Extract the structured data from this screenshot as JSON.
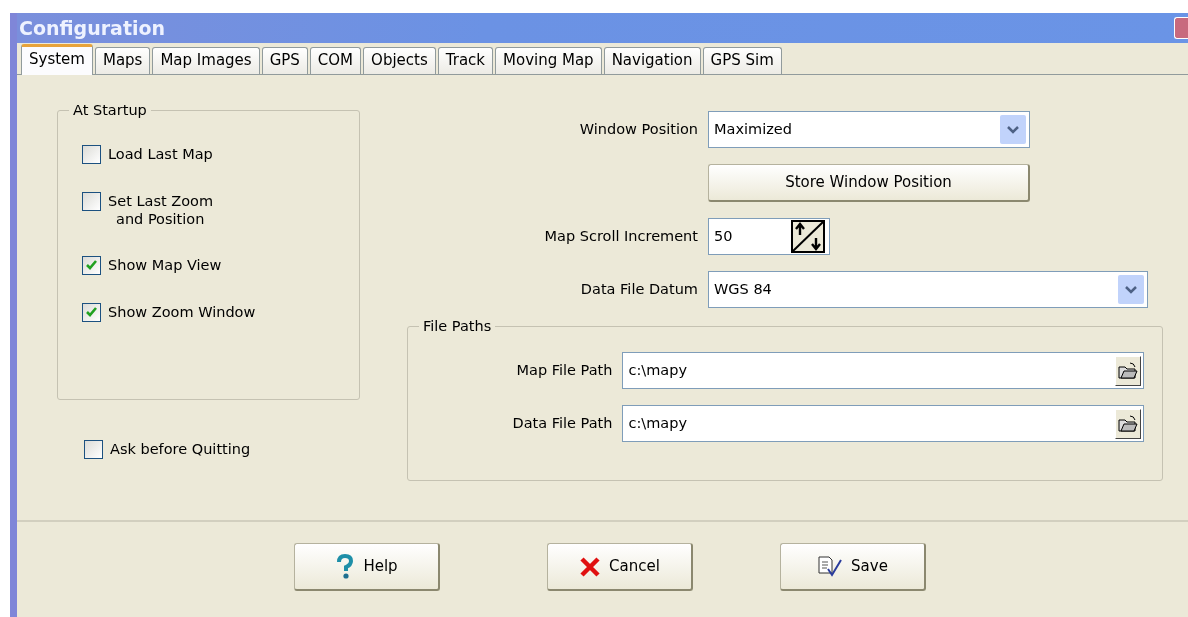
{
  "window": {
    "title": "Configuration"
  },
  "tabs": [
    {
      "label": "System",
      "selected": true
    },
    {
      "label": "Maps",
      "selected": false
    },
    {
      "label": "Map Images",
      "selected": false
    },
    {
      "label": "GPS",
      "selected": false
    },
    {
      "label": "COM",
      "selected": false
    },
    {
      "label": "Objects",
      "selected": false
    },
    {
      "label": "Track",
      "selected": false
    },
    {
      "label": "Moving Map",
      "selected": false
    },
    {
      "label": "Navigation",
      "selected": false
    },
    {
      "label": "GPS Sim",
      "selected": false
    }
  ],
  "startup": {
    "legend": "At Startup",
    "options": [
      {
        "lines": [
          "Load Last Map"
        ],
        "checked": false
      },
      {
        "lines": [
          "Set Last Zoom",
          "and Position"
        ],
        "checked": false
      },
      {
        "lines": [
          "Show Map View"
        ],
        "checked": true
      },
      {
        "lines": [
          "Show Zoom Window"
        ],
        "checked": true
      }
    ]
  },
  "ask_before_quitting": {
    "lines": [
      "Ask before Quitting"
    ],
    "checked": false
  },
  "window_position": {
    "label": "Window Position",
    "value": "Maximized"
  },
  "store_button": "Store Window Position",
  "scroll_increment": {
    "label": "Map Scroll Increment",
    "value": "50"
  },
  "datum": {
    "label": "Data File Datum",
    "value": "WGS 84"
  },
  "file_paths": {
    "legend": "File Paths",
    "fields": [
      {
        "label": "Map File Path",
        "value": "c:\\mapy"
      },
      {
        "label": "Data File Path",
        "value": "c:\\mapy"
      }
    ]
  },
  "buttons": [
    {
      "label": "Help",
      "kind": "help"
    },
    {
      "label": "Cancel",
      "kind": "cancel"
    },
    {
      "label": "Save",
      "kind": "save"
    }
  ]
}
